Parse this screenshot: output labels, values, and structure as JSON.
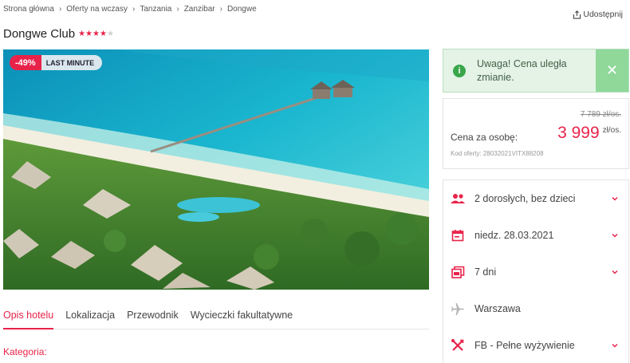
{
  "breadcrumb": [
    "Strona główna",
    "Oferty na wczasy",
    "Tanzania",
    "Zanzibar",
    "Dongwe"
  ],
  "share_label": "Udostępnij",
  "hotel": {
    "name": "Dongwe Club",
    "stars": 4,
    "max_stars": 5
  },
  "badges": {
    "discount": "-49%",
    "tag": "LAST MINUTE"
  },
  "tabs": [
    {
      "label": "Opis hotelu",
      "active": true
    },
    {
      "label": "Lokalizacja",
      "active": false
    },
    {
      "label": "Przewodnik",
      "active": false
    },
    {
      "label": "Wycieczki fakultatywne",
      "active": false
    }
  ],
  "section_label": "Kategoria:",
  "alert": {
    "text": "Uwaga! Cena uległa zmianie.",
    "close": "✕"
  },
  "price": {
    "old": "7 789 zł/os.",
    "label": "Cena za osobę:",
    "value": "3 999",
    "unit": "zł/os.",
    "offer_code": "Kod oferty: 28032021VITX88208"
  },
  "options": [
    {
      "icon": "people-icon",
      "label": "2 dorosłych, bez dzieci",
      "dropdown": true
    },
    {
      "icon": "calendar-icon",
      "label": "niedz. 28.03.2021",
      "dropdown": true
    },
    {
      "icon": "duration-icon",
      "label": "7 dni",
      "dropdown": true
    },
    {
      "icon": "plane-icon",
      "label": "Warszawa",
      "dropdown": false
    },
    {
      "icon": "cutlery-icon",
      "label": "FB - Pełne wyżywienie",
      "dropdown": true
    }
  ],
  "colors": {
    "accent": "#e8234a",
    "alert_bg": "#e4f3e6",
    "alert_close": "#8fd89a"
  }
}
